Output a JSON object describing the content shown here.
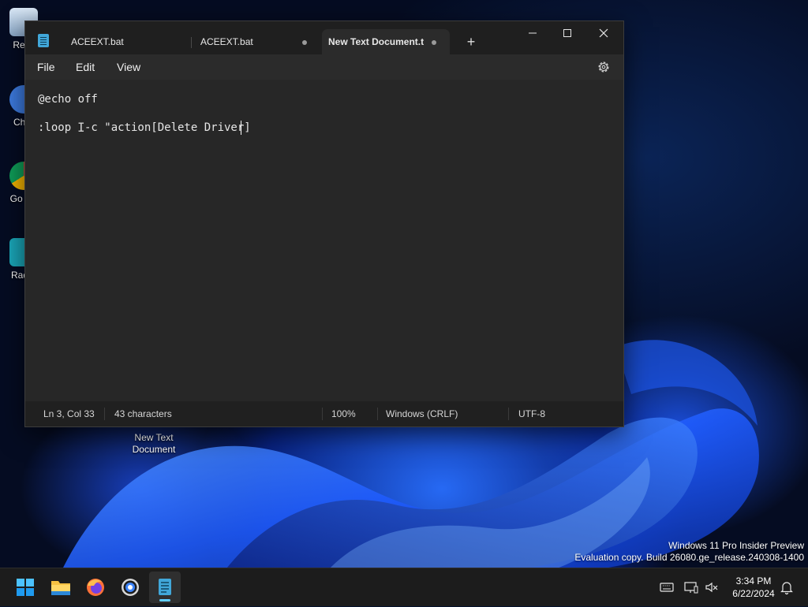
{
  "desktop": {
    "icons": [
      {
        "label": "Recy"
      },
      {
        "label": "Chro"
      },
      {
        "label": "Go Ch"
      },
      {
        "label": "Radm"
      },
      {
        "label": "New Text Document"
      }
    ],
    "watermark": {
      "line1": "Windows 11 Pro Insider Preview",
      "line2": "Evaluation copy. Build 26080.ge_release.240308-1400"
    }
  },
  "window": {
    "tabs": [
      {
        "label": "ACEEXT.bat",
        "active": false,
        "modified": false
      },
      {
        "label": "ACEEXT.bat",
        "active": false,
        "modified": true
      },
      {
        "label": "New Text Document.t",
        "active": true,
        "modified": true
      }
    ],
    "new_tab_symbol": "+",
    "menu": {
      "file": "File",
      "edit": "Edit",
      "view": "View"
    },
    "editor": {
      "lines": [
        "@echo off",
        "",
        ":loop  -c \"action[Delete Driver]"
      ]
    },
    "status": {
      "position": "Ln 3, Col 33",
      "characters": "43 characters",
      "zoom": "100%",
      "line_ending": "Windows (CRLF)",
      "encoding": "UTF-8"
    }
  },
  "taskbar": {
    "apps": [
      "start-icon",
      "file-explorer-icon",
      "firefox-icon",
      "chrome-icon",
      "notepad-icon"
    ],
    "clock": {
      "time": "3:34 PM",
      "date": "6/22/2024"
    }
  },
  "colors": {
    "accent": "#60cdff",
    "window_bg": "#272727",
    "titlebar_bg": "#1f1f1f"
  }
}
